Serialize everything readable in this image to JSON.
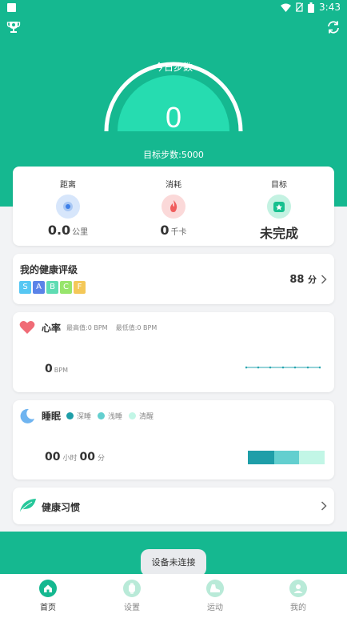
{
  "status_bar": {
    "time": "3:43"
  },
  "hero": {
    "gauge_label": "今日步数",
    "steps": "0",
    "target": "目标步数:5000"
  },
  "stats": {
    "distance": {
      "label": "距离",
      "value": "0.0",
      "unit": "公里"
    },
    "calories": {
      "label": "消耗",
      "value": "0",
      "unit": "千卡"
    },
    "goal": {
      "label": "目标",
      "value": "未完成"
    }
  },
  "rating": {
    "title": "我的健康评级",
    "grades": [
      "S",
      "A",
      "B",
      "C",
      "F"
    ],
    "score": "88",
    "unit": "分"
  },
  "heart": {
    "title": "心率",
    "max_label": "最高值:0  BPM",
    "min_label": "最低值:0  BPM",
    "value": "0",
    "unit": "BPM"
  },
  "sleep": {
    "title": "睡眠",
    "legend": [
      "深睡",
      "浅睡",
      "清醒"
    ],
    "hours": "00",
    "hours_unit": "小时",
    "minutes": "00",
    "minutes_unit": "分"
  },
  "habit": {
    "title": "健康习惯"
  },
  "toast": "设备未连接",
  "tabs": [
    {
      "label": "首页",
      "icon": "home-icon"
    },
    {
      "label": "设置",
      "icon": "watch-icon"
    },
    {
      "label": "运动",
      "icon": "shoe-icon"
    },
    {
      "label": "我的",
      "icon": "user-icon"
    }
  ],
  "colors": {
    "brand": "#15b890",
    "gauge": "#26dcb0",
    "deep_sleep": "#1e9ea8",
    "light_sleep": "#63cfcf",
    "awake": "#c2f6e6"
  }
}
